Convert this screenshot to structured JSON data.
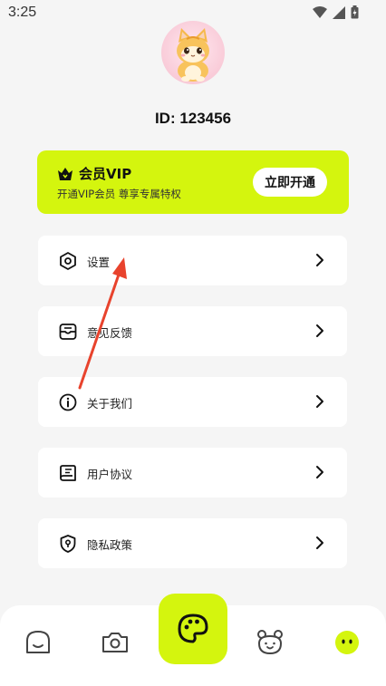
{
  "status_bar": {
    "time": "3:25",
    "icons": [
      "wifi-icon",
      "signal-icon",
      "battery-icon"
    ]
  },
  "profile": {
    "id_label": "ID: 123456"
  },
  "vip": {
    "title": "会员VIP",
    "subtitle": "开通VIP会员  尊享专属特权",
    "button_label": "立即开通",
    "accent_color": "#d4f50e"
  },
  "menu": {
    "items": [
      {
        "label": "设置",
        "icon": "settings-hexagon-icon"
      },
      {
        "label": "意见反馈",
        "icon": "feedback-icon"
      },
      {
        "label": "关于我们",
        "icon": "info-icon"
      },
      {
        "label": "用户协议",
        "icon": "agreement-icon"
      },
      {
        "label": "隐私政策",
        "icon": "privacy-shield-icon"
      }
    ]
  },
  "tab_bar": {
    "tabs": [
      "home-face-icon",
      "camera-icon",
      "palette-icon",
      "bear-icon",
      "profile-face-icon"
    ],
    "active": "palette-icon"
  }
}
